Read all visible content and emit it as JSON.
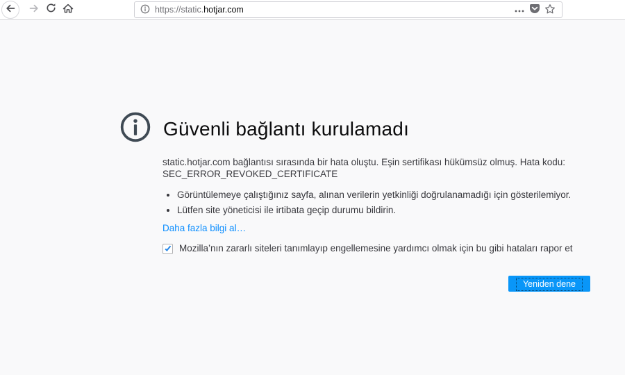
{
  "toolbar": {
    "url_prefix": "https://static.",
    "url_domain": "hotjar.com"
  },
  "error_page": {
    "title": "Güvenli bağlantı kurulamadı",
    "description": "static.hotjar.com bağlantısı sırasında bir hata oluştu. Eşin sertifikası hükümsüz olmuş. Hata kodu:",
    "error_code": "SEC_ERROR_REVOKED_CERTIFICATE",
    "bullets": [
      "Görüntülemeye çalıştığınız sayfa, alınan verilerin yetkinliği doğrulanamadığı için gösterilemiyor.",
      "Lütfen site yöneticisi ile irtibata geçip durumu bildirin."
    ],
    "learn_more_link": "Daha fazla bilgi al…",
    "report_checkbox_label": "Mozilla’nın zararlı siteleri tanımlayıp engellemesine yardımcı olmak için bu gibi hataları rapor et",
    "checkbox_checked": true,
    "retry_button_label": "Yeniden dene"
  },
  "colors": {
    "accent_button": "#0996f8",
    "link": "#0a8dff",
    "error_icon": "#3f4a54",
    "toolbar_icon": "#4c4c50",
    "disabled_icon": "#b8b8bc",
    "page_background": "#f9f9fa"
  }
}
